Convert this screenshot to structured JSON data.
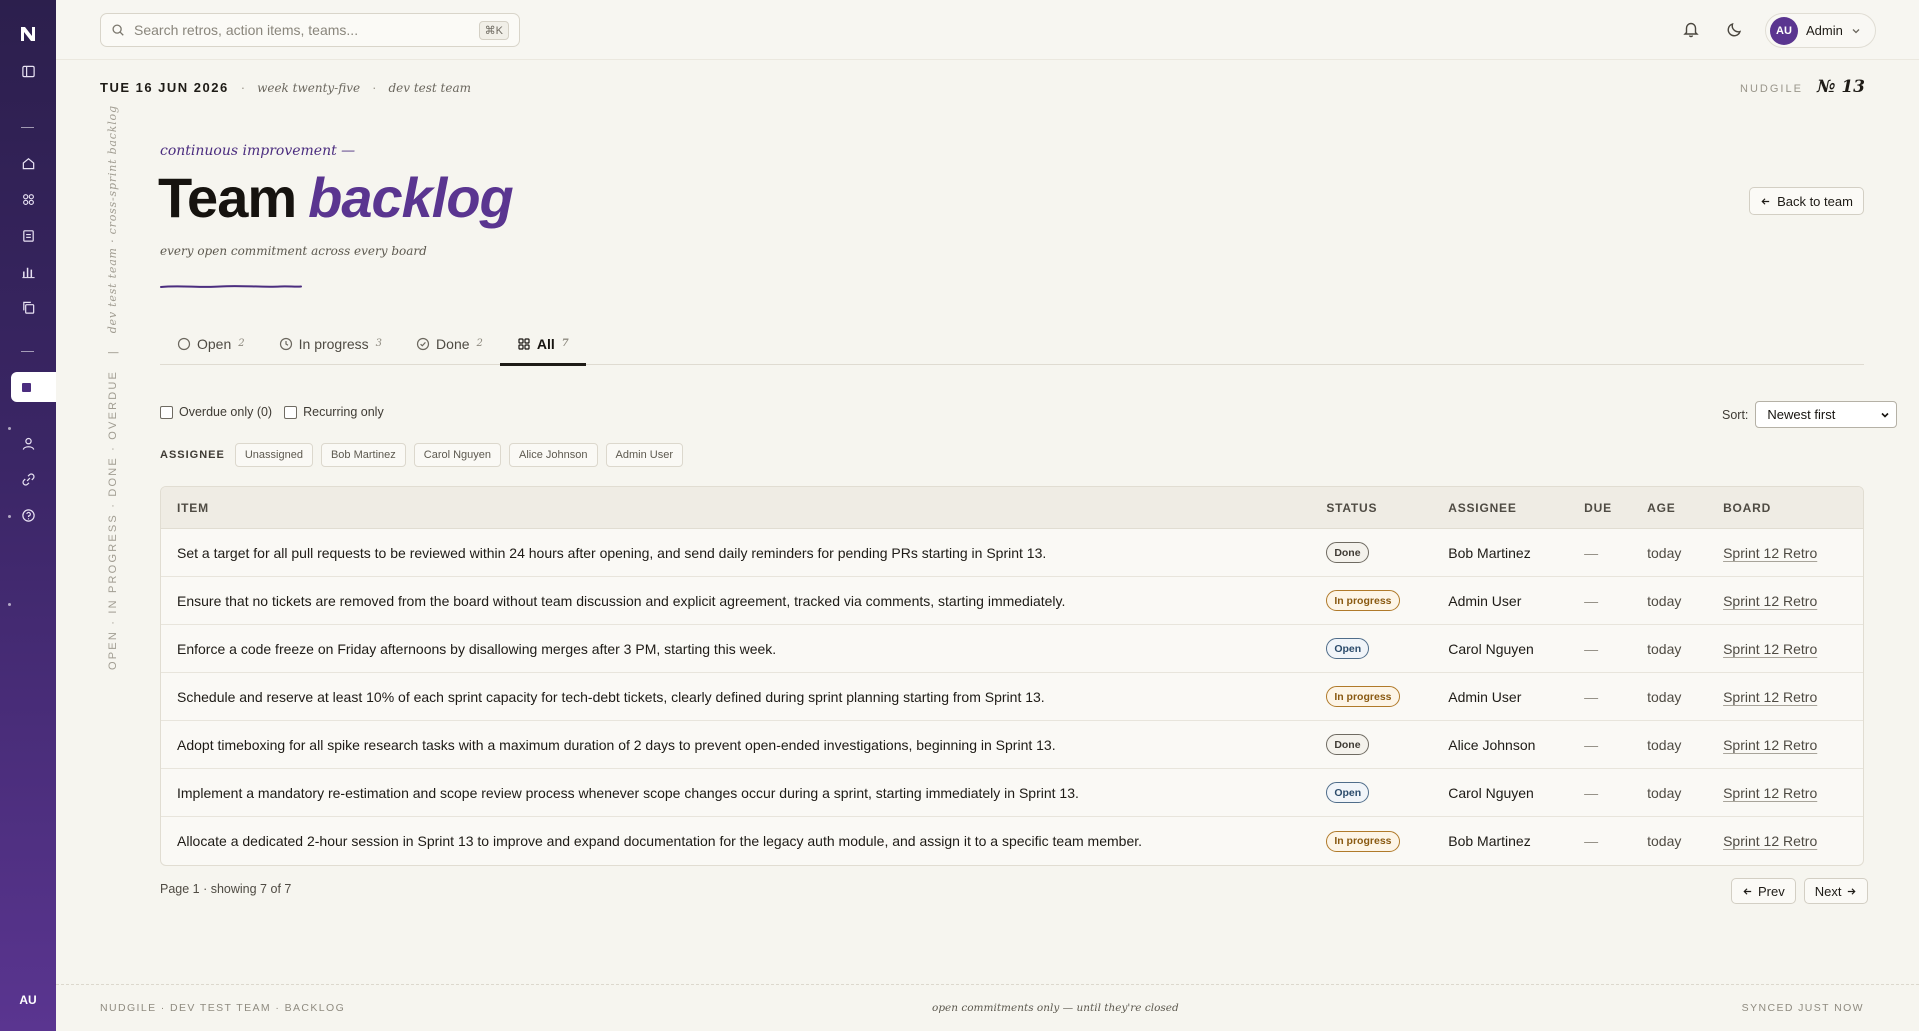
{
  "app": {
    "name": "NUDGILE",
    "user_initials": "AU",
    "user_name": "Admin",
    "accent_color": "#5a3590"
  },
  "sidebar": {
    "icons": [
      "logo-icon",
      "panel-toggle-icon",
      "home-icon",
      "grid-icon",
      "clipboard-icon",
      "bar-chart-icon",
      "copy-icon",
      "board-icon",
      "user-icon",
      "link-icon",
      "help-icon"
    ]
  },
  "search": {
    "placeholder": "Search retros, action items, teams...",
    "shortcut": "⌘K"
  },
  "meta": {
    "date": "TUE 16 JUN 2026",
    "week": "week twenty-five",
    "team": "dev test team",
    "issue_label": "NUDGILE",
    "issue_number": "№ 13"
  },
  "side_caption": {
    "statuses": "OPEN · IN PROGRESS · DONE · OVERDUE",
    "divider": "|",
    "script": "dev test team · cross-sprint backlog"
  },
  "header": {
    "kicker": "continuous improvement —",
    "title_plain": "Team",
    "title_accent": "backlog",
    "subtitle": "every open commitment across every board",
    "back_label": "Back to team"
  },
  "tabs": [
    {
      "label": "Open",
      "count": "2"
    },
    {
      "label": "In progress",
      "count": "3"
    },
    {
      "label": "Done",
      "count": "2"
    },
    {
      "label": "All",
      "count": "7"
    }
  ],
  "filters": {
    "overdue_label": "Overdue only (0)",
    "recurring_label": "Recurring only",
    "sort_label": "Sort:",
    "sort_value": "Newest first",
    "assignee_label": "ASSIGNEE",
    "assignees": [
      "Unassigned",
      "Bob Martinez",
      "Carol Nguyen",
      "Alice Johnson",
      "Admin User"
    ]
  },
  "table": {
    "headers": {
      "item": "ITEM",
      "status": "STATUS",
      "assignee": "ASSIGNEE",
      "due": "DUE",
      "age": "AGE",
      "board": "BOARD"
    },
    "rows": [
      {
        "item": "Set a target for all pull requests to be reviewed within 24 hours after opening, and send daily reminders for pending PRs starting in Sprint 13.",
        "status": "Done",
        "assignee": "Bob Martinez",
        "due": "—",
        "age": "today",
        "board": "Sprint 12 Retro"
      },
      {
        "item": "Ensure that no tickets are removed from the board without team discussion and explicit agreement, tracked via comments, starting immediately.",
        "status": "In progress",
        "assignee": "Admin User",
        "due": "—",
        "age": "today",
        "board": "Sprint 12 Retro"
      },
      {
        "item": "Enforce a code freeze on Friday afternoons by disallowing merges after 3 PM, starting this week.",
        "status": "Open",
        "assignee": "Carol Nguyen",
        "due": "—",
        "age": "today",
        "board": "Sprint 12 Retro"
      },
      {
        "item": "Schedule and reserve at least 10% of each sprint capacity for tech-debt tickets, clearly defined during sprint planning starting from Sprint 13.",
        "status": "In progress",
        "assignee": "Admin User",
        "due": "—",
        "age": "today",
        "board": "Sprint 12 Retro"
      },
      {
        "item": "Adopt timeboxing for all spike research tasks with a maximum duration of 2 days to prevent open-ended investigations, beginning in Sprint 13.",
        "status": "Done",
        "assignee": "Alice Johnson",
        "due": "—",
        "age": "today",
        "board": "Sprint 12 Retro"
      },
      {
        "item": "Implement a mandatory re-estimation and scope review process whenever scope changes occur during a sprint, starting immediately in Sprint 13.",
        "status": "Open",
        "assignee": "Carol Nguyen",
        "due": "—",
        "age": "today",
        "board": "Sprint 12 Retro"
      },
      {
        "item": "Allocate a dedicated 2-hour session in Sprint 13 to improve and expand documentation for the legacy auth module, and assign it to a specific team member.",
        "status": "In progress",
        "assignee": "Bob Martinez",
        "due": "—",
        "age": "today",
        "board": "Sprint 12 Retro"
      }
    ]
  },
  "pagination": {
    "info": "Page 1 · showing 7 of 7",
    "prev": "Prev",
    "next": "Next"
  },
  "footer": {
    "left": "NUDGILE · DEV TEST TEAM · BACKLOG",
    "center": "open commitments only — until they're closed",
    "right": "SYNCED JUST NOW"
  }
}
